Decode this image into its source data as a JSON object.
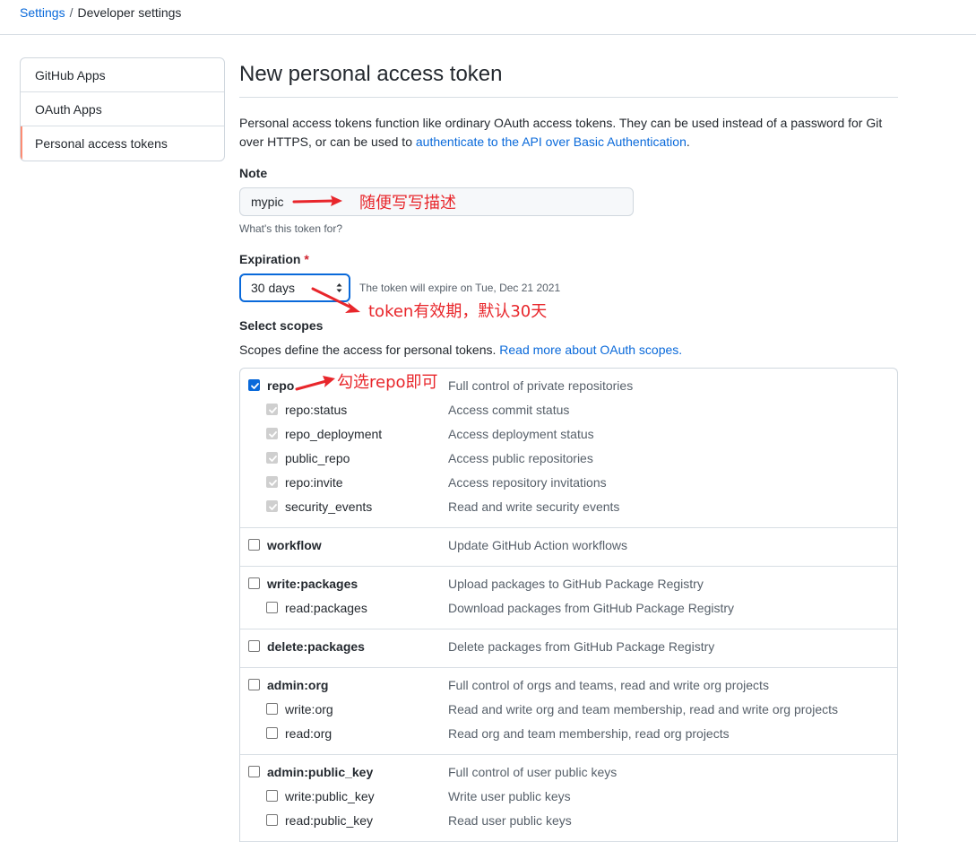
{
  "breadcrumb": {
    "settings": "Settings",
    "separator": "/",
    "current": "Developer settings"
  },
  "sidebar": {
    "items": [
      {
        "label": "GitHub Apps"
      },
      {
        "label": "OAuth Apps"
      },
      {
        "label": "Personal access tokens",
        "selected": true
      }
    ]
  },
  "page": {
    "title": "New personal access token",
    "intro_text": "Personal access tokens function like ordinary OAuth access tokens. They can be used instead of a password for Git over HTTPS, or can be used to ",
    "intro_link": "authenticate to the API over Basic Authentication",
    "intro_end": "."
  },
  "note": {
    "label": "Note",
    "value": "mypic",
    "hint": "What's this token for?"
  },
  "expiration": {
    "label": "Expiration",
    "required_mark": "*",
    "selected": "30 days",
    "note": "The token will expire on Tue, Dec 21 2021"
  },
  "scopes": {
    "label": "Select scopes",
    "desc_text": "Scopes define the access for personal tokens. ",
    "desc_link": "Read more about OAuth scopes.",
    "groups": [
      {
        "name": "repo",
        "desc": "Full control of private repositories",
        "checked": true,
        "subs": [
          {
            "name": "repo:status",
            "desc": "Access commit status",
            "checked": true
          },
          {
            "name": "repo_deployment",
            "desc": "Access deployment status",
            "checked": true
          },
          {
            "name": "public_repo",
            "desc": "Access public repositories",
            "checked": true
          },
          {
            "name": "repo:invite",
            "desc": "Access repository invitations",
            "checked": true
          },
          {
            "name": "security_events",
            "desc": "Read and write security events",
            "checked": true
          }
        ]
      },
      {
        "name": "workflow",
        "desc": "Update GitHub Action workflows",
        "checked": false,
        "subs": []
      },
      {
        "name": "write:packages",
        "desc": "Upload packages to GitHub Package Registry",
        "checked": false,
        "subs": [
          {
            "name": "read:packages",
            "desc": "Download packages from GitHub Package Registry",
            "checked": false
          }
        ]
      },
      {
        "name": "delete:packages",
        "desc": "Delete packages from GitHub Package Registry",
        "checked": false,
        "subs": []
      },
      {
        "name": "admin:org",
        "desc": "Full control of orgs and teams, read and write org projects",
        "checked": false,
        "subs": [
          {
            "name": "write:org",
            "desc": "Read and write org and team membership, read and write org projects",
            "checked": false
          },
          {
            "name": "read:org",
            "desc": "Read org and team membership, read org projects",
            "checked": false
          }
        ]
      },
      {
        "name": "admin:public_key",
        "desc": "Full control of user public keys",
        "checked": false,
        "subs": [
          {
            "name": "write:public_key",
            "desc": "Write user public keys",
            "checked": false
          },
          {
            "name": "read:public_key",
            "desc": "Read user public keys",
            "checked": false
          }
        ]
      }
    ]
  },
  "annotations": {
    "note": "随便写写描述",
    "expiration": "token有效期，默认30天",
    "repo": "勾选repo即可",
    "color": "#e8262b"
  }
}
